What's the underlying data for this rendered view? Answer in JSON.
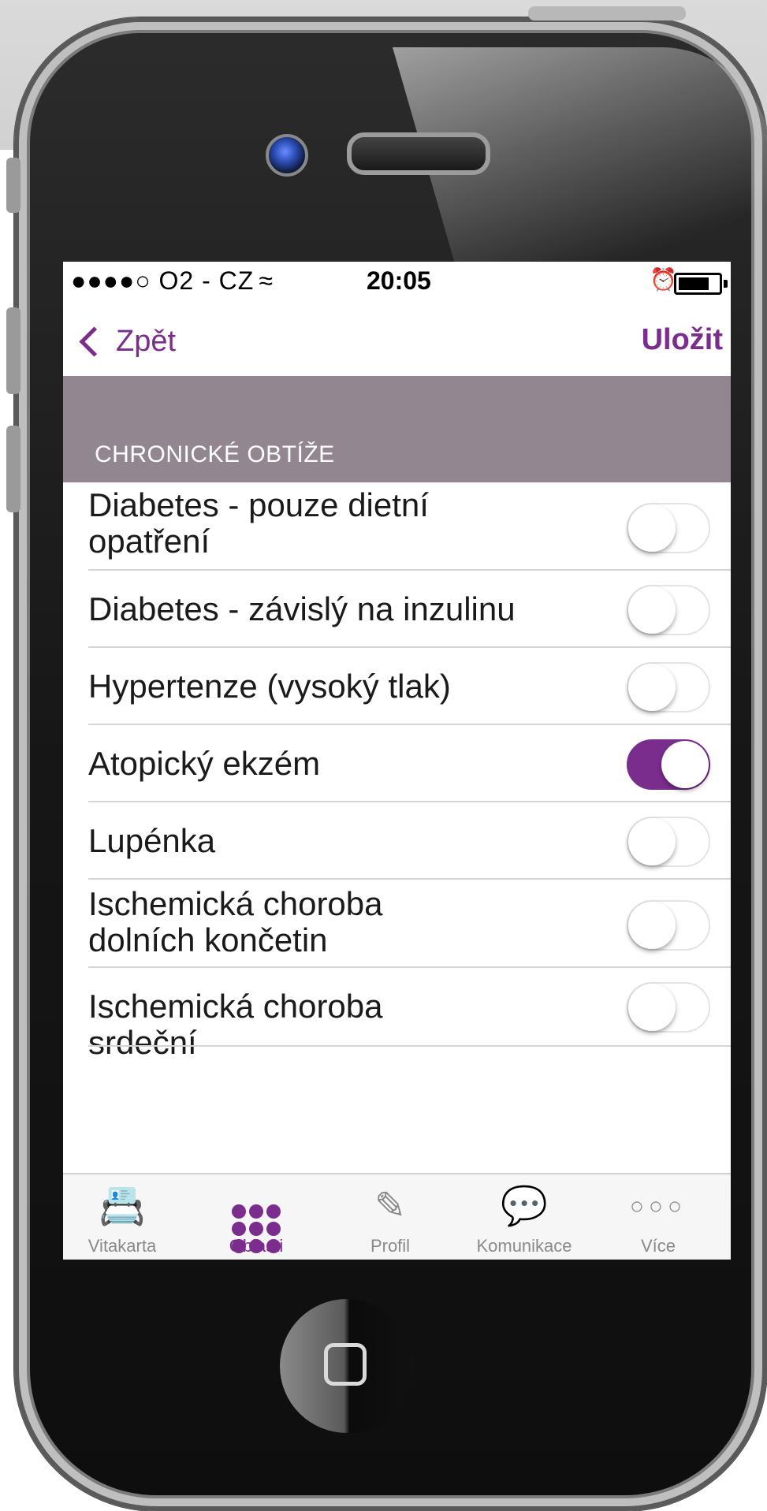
{
  "status_bar": {
    "carrier": "●●●●○ O2 - CZ",
    "time": "20:05"
  },
  "nav": {
    "back_label": "Zpět",
    "save_label": "Uložit"
  },
  "section": {
    "title": "CHRONICKÉ OBTÍŽE"
  },
  "items": [
    {
      "label": "Diabetes - pouze dietní opatření",
      "on": false
    },
    {
      "label": "Diabetes - závislý na inzulinu",
      "on": false
    },
    {
      "label": "Hypertenze (vysoký tlak)",
      "on": false
    },
    {
      "label": "Atopický ekzém",
      "on": true
    },
    {
      "label": "Lupénka",
      "on": false
    },
    {
      "label": "Ischemická choroba dolních končetin",
      "on": false
    },
    {
      "label": "Ischemická choroba srdeční",
      "on": false
    }
  ],
  "tabs": [
    {
      "label": "Vitakarta",
      "icon": "id-card-icon",
      "active": false
    },
    {
      "label": "Oblasti",
      "icon": "grid-dots-icon",
      "active": true
    },
    {
      "label": "Profil",
      "icon": "edit-profile-icon",
      "active": false
    },
    {
      "label": "Komunikace",
      "icon": "chat-bubbles-icon",
      "active": false
    },
    {
      "label": "Více",
      "icon": "more-icon",
      "active": false
    }
  ],
  "colors": {
    "accent": "#7b2d8e",
    "section_bg": "#928791",
    "tab_inactive": "#8a8a8a"
  }
}
